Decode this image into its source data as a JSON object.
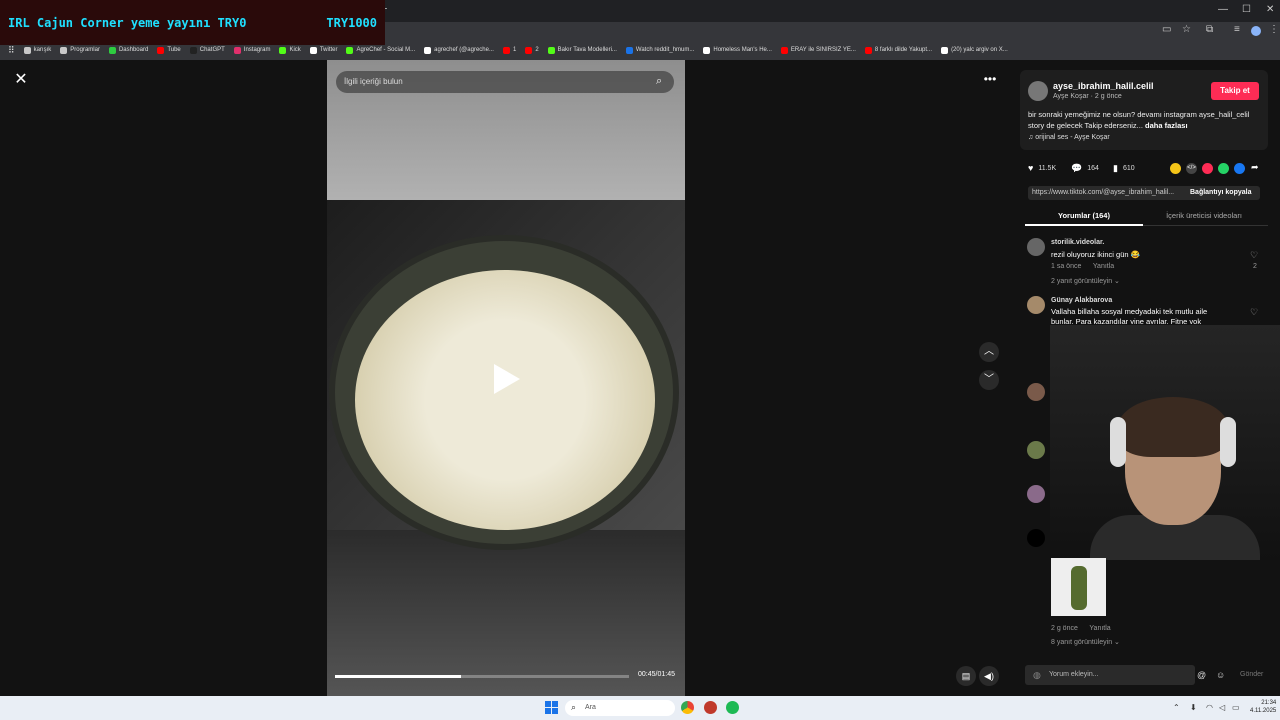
{
  "overlay": {
    "title": "IRL Cajun Corner yeme yayını  TRY0",
    "amount": "TRY1000"
  },
  "window": {
    "minimize": "—",
    "maximize": "☐",
    "close": "✕"
  },
  "bookmarks": [
    {
      "label": "karışık",
      "color": "#c8c8c8"
    },
    {
      "label": "Programlar",
      "color": "#c8c8c8"
    },
    {
      "label": "Dashboard",
      "color": "#2ecc40"
    },
    {
      "label": "Tube",
      "color": "#ff0000"
    },
    {
      "label": "ChatGPT",
      "color": "#222222"
    },
    {
      "label": "Instagram",
      "color": "#e1306c"
    },
    {
      "label": "Kick",
      "color": "#53fc18"
    },
    {
      "label": "Twitter",
      "color": "#ffffff"
    },
    {
      "label": "AgreChef - Social M...",
      "color": "#53fc18"
    },
    {
      "label": "agrechef (@agreche...",
      "color": "#ffffff"
    },
    {
      "label": "1",
      "color": "#ff0000"
    },
    {
      "label": "2",
      "color": "#ff0000"
    },
    {
      "label": "Bakır Tava Modelleri...",
      "color": "#53fc18"
    },
    {
      "label": "Watch reddit_hmum...",
      "color": "#1a73e8"
    },
    {
      "label": "Homeless Man's He...",
      "color": "#ffffff"
    },
    {
      "label": "ERAY ile SINIRSIZ YE...",
      "color": "#ff0000"
    },
    {
      "label": "8 farklı dilde Yakupt...",
      "color": "#ff0000"
    },
    {
      "label": "(20) yalc argiv on X...",
      "color": "#ffffff"
    }
  ],
  "video": {
    "search_placeholder": "İlgili içeriği bulun",
    "time": "00:45/01:45",
    "progress": 0.43
  },
  "author": {
    "username": "ayse_ibrahim_halil.celil",
    "sub": "Ayşe Koşar · 2 g önce",
    "follow_label": "Takip et",
    "description": "bir sonraki yemeğimiz ne olsun? devamı instagram ayse_halil_celil story de gelecek Takip ederseniz...",
    "more": "daha fazlası",
    "sound": "♫  orijinal ses - Ayşe Koşar"
  },
  "stats": {
    "likes": "11.5K",
    "comments": "164",
    "saves": "610"
  },
  "link": {
    "url": "https://www.tiktok.com/@ayse_ibrahim_halil...",
    "copy_label": "Bağlantıyı kopyala"
  },
  "tabs": {
    "comments": "Yorumlar (164)",
    "creator_videos": "İçerik üreticisi videoları"
  },
  "comments": [
    {
      "name": "storilik.videolar.",
      "text": "rezil oluyoruz ikinci gün 😂",
      "meta": "1 sa önce      Yanıtla",
      "replies": "2 yanıt görüntüleyin ⌄",
      "likes": "2"
    },
    {
      "name": "Günay Alakbarova",
      "text": "Vallaha billaha sosyal medyadaki tek mutlu aile",
      "text2": "bunlar. Para kazandılar yine ayrılar. Fitne yok"
    },
    {
      "meta": "2 g önce      Yanıtla",
      "replies": "8 yanıt görüntüleyin ⌄"
    }
  ],
  "comment_input": {
    "placeholder": "Yorum ekleyin...",
    "send": "Gönder"
  },
  "taskbar": {
    "search": "Ara",
    "time": "21:34",
    "date": "4.11.2025"
  }
}
